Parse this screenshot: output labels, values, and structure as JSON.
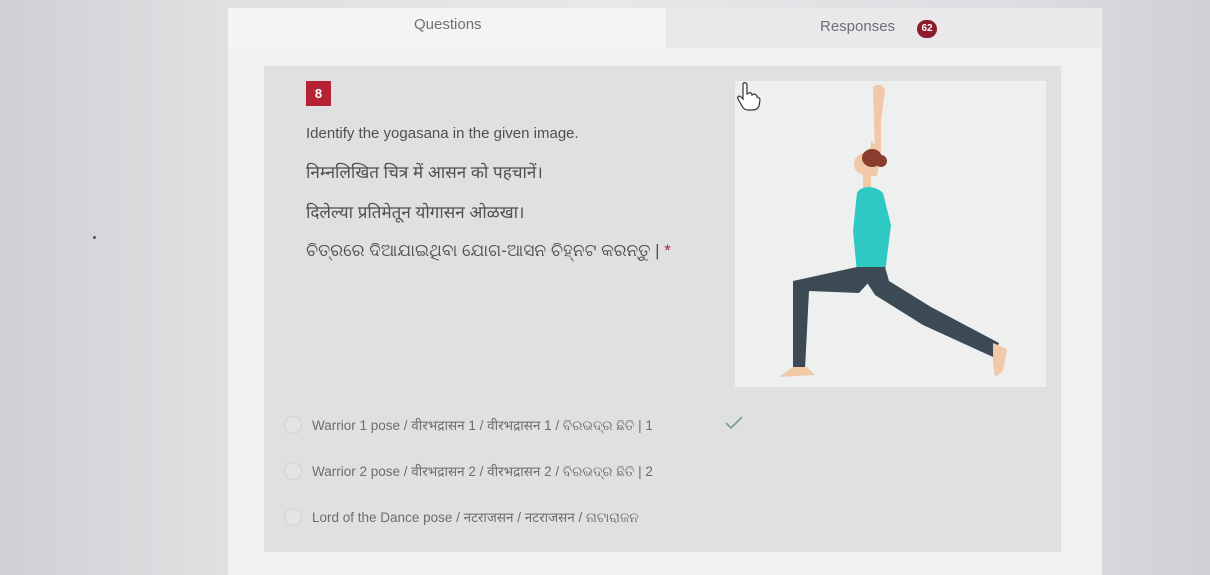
{
  "tabs": {
    "questions_label": "Questions",
    "responses_label": "Responses",
    "responses_count": "62"
  },
  "question": {
    "number": "8",
    "text_en": "Identify the yogasana in the given image.",
    "text_hi": "निम्नलिखित चित्र में आसन को पहचानें।",
    "text_mr": "दिलेल्या प्रतिमेतून योगासन ओळखा।",
    "text_or": "ଚିତ୍ରରେ ଦିଆଯାଇଥିବା ଯୋଗ-ଆସନ ଚିହ୍ନଟ କରନ୍ତୁ |",
    "required_mark": "*",
    "image_icon": "yoga-warrior-pose-illustration",
    "cursor_icon": "hand-pointer-icon"
  },
  "options": [
    {
      "label": "Warrior 1 pose / वीरभद्रासन 1 / वीरभद्रासन 1 / ବିରଭଦ୍ର ଛିତି | 1",
      "correct": true
    },
    {
      "label": "Warrior 2 pose / वीरभद्रासन 2 / वीरभद्रासन 2 / ବିରଭଦ୍ର ଛିତି | 2",
      "correct": false
    },
    {
      "label": "Lord of the Dance pose / नटराजसन / नटराजसन / ନାଟାରାଜନ",
      "correct": false
    }
  ],
  "colors": {
    "accent": "#b52234",
    "badge": "#8c1b2e",
    "check": "#7a9a8a"
  }
}
